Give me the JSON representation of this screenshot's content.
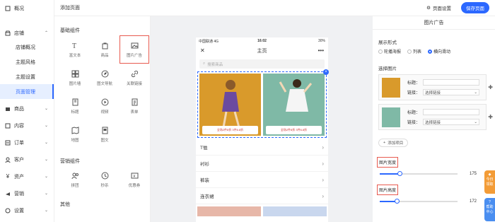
{
  "sidebar": {
    "top_item": "概况",
    "store": {
      "label": "店铺",
      "children": [
        "店铺概况",
        "主题风格",
        "主题设置",
        "页面管理"
      ],
      "active": "页面管理"
    },
    "items": [
      "商品",
      "内容",
      "订单",
      "客户",
      "资产",
      "营销",
      "设置"
    ]
  },
  "topbar": {
    "title": "添加页面",
    "settings_label": "页面设置",
    "save_label": "保存页面"
  },
  "components": {
    "basic": {
      "title": "基础组件",
      "items": [
        "富文本",
        "商品",
        "图片广告",
        "图片墙",
        "图文导航",
        "关联链接",
        "标题",
        "视频",
        "表单",
        "地图",
        "图文"
      ]
    },
    "marketing": {
      "title": "营销组件",
      "items": [
        "拼团",
        "秒杀",
        "优惠券"
      ]
    },
    "other": {
      "title": "其他"
    }
  },
  "phone": {
    "carrier": "中国联通  4G",
    "time": "16:02",
    "battery": "30%",
    "nav_title": "主页",
    "search_placeholder": "搜索商品",
    "ad_banner": "全场2件8折 3件6.8折",
    "categories": [
      "T恤",
      "衬衫",
      "裤装",
      "连衣裙"
    ]
  },
  "panel": {
    "title": "图片广告",
    "display_label": "展示形式",
    "display_options": [
      "轮播海报",
      "列表",
      "横向滑动"
    ],
    "display_selected": 2,
    "select_label": "选择图片",
    "title_field": "标题：",
    "link_field": "链接：",
    "link_placeholder": "选择链接",
    "add_label": "添加项目",
    "width_label": "图片宽度",
    "width_value": "175",
    "width_fraction": 0.25,
    "height_label": "图片高度",
    "height_value": "172",
    "height_fraction": 0.22
  },
  "floats": [
    "今日 领取",
    "帮助 中心"
  ]
}
